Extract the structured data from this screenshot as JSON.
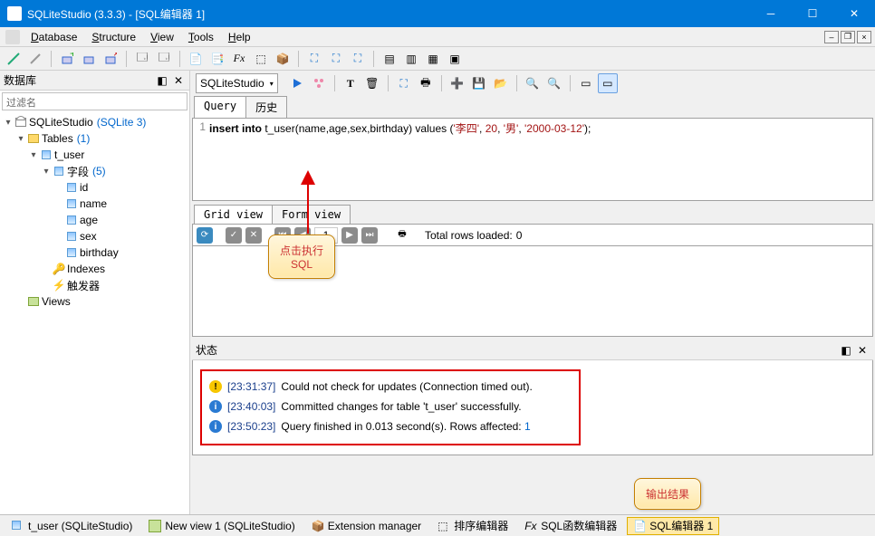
{
  "title_bar": {
    "title": "SQLiteStudio (3.3.3) - [SQL编辑器  1]"
  },
  "menu": [
    "Database",
    "Structure",
    "View",
    "Tools",
    "Help"
  ],
  "left_panel": {
    "title": "数据库",
    "filter_placeholder": "过滤名",
    "db_name": "SQLiteStudio",
    "db_type": "(SQLite 3)",
    "tables_label": "Tables",
    "tables_count": "(1)",
    "table_name": "t_user",
    "fields_label": "字段",
    "fields_count": "(5)",
    "columns": [
      "id",
      "name",
      "age",
      "sex",
      "birthday"
    ],
    "indexes_label": "Indexes",
    "triggers_label": "触发器",
    "views_label": "Views"
  },
  "editor": {
    "combo": "SQLiteStudio",
    "tabs": {
      "query": "Query",
      "history": "历史"
    },
    "sql_prefix": "insert into ",
    "sql_table": "t_user",
    "sql_cols": "(name,age,sex,birthday) values (",
    "sql_v1": "'李四'",
    "sql_c": ", ",
    "sql_v2": "20",
    "sql_v3": "'男'",
    "sql_v4": "'2000-03-12'",
    "sql_end": ");"
  },
  "grid": {
    "tabs": {
      "grid": "Grid view",
      "form": "Form view"
    },
    "page": "1",
    "total_label": "Total rows loaded: ",
    "total_value": "0"
  },
  "status": {
    "title": "状态",
    "messages": [
      {
        "type": "warn",
        "ts": "[23:31:37]",
        "text": "Could not check for updates (Connection timed out)."
      },
      {
        "type": "info",
        "ts": "[23:40:03]",
        "text": "Committed changes for table 't_user' successfully."
      },
      {
        "type": "info",
        "ts": "[23:50:23]",
        "text": "Query finished in 0.013 second(s). Rows affected: ",
        "link": "1"
      }
    ]
  },
  "callouts": {
    "exec1": "点击执行",
    "exec2": "SQL",
    "result": "输出结果"
  },
  "status_bar": {
    "items": [
      "t_user (SQLiteStudio)",
      "New view 1 (SQLiteStudio)",
      "Extension manager",
      "排序编辑器",
      "SQL函数编辑器",
      "SQL编辑器  1"
    ]
  }
}
